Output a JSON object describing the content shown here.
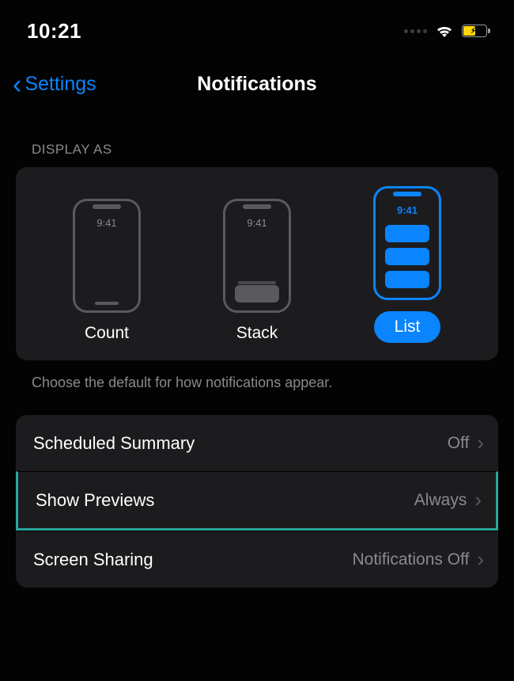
{
  "status": {
    "time": "10:21"
  },
  "nav": {
    "back_label": "Settings",
    "title": "Notifications"
  },
  "display_as": {
    "header": "DISPLAY AS",
    "phone_time": "9:41",
    "options": {
      "count": "Count",
      "stack": "Stack",
      "list": "List"
    },
    "helper": "Choose the default for how notifications appear."
  },
  "rows": {
    "scheduled": {
      "label": "Scheduled Summary",
      "value": "Off"
    },
    "previews": {
      "label": "Show Previews",
      "value": "Always"
    },
    "sharing": {
      "label": "Screen Sharing",
      "value": "Notifications Off"
    }
  }
}
